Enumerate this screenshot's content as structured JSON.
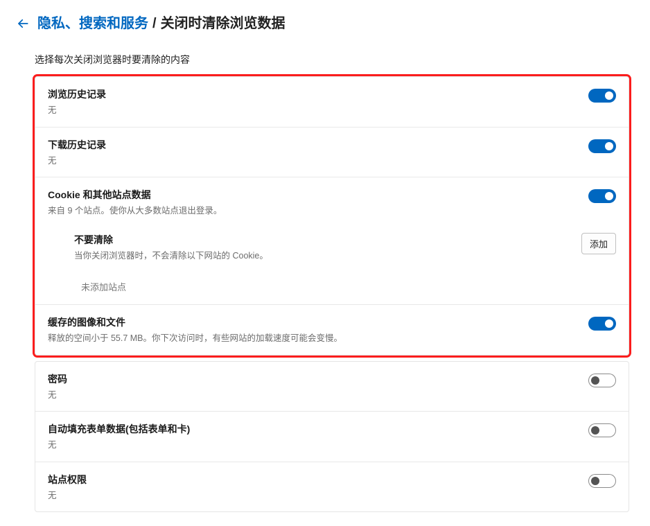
{
  "header": {
    "breadcrumb_parent": "隐私、搜索和服务",
    "breadcrumb_sep": "/",
    "breadcrumb_current": "关闭时清除浏览数据"
  },
  "intro": "选择每次关闭浏览器时要清除的内容",
  "items": [
    {
      "title": "浏览历史记录",
      "sub": "无",
      "on": true
    },
    {
      "title": "下载历史记录",
      "sub": "无",
      "on": true
    },
    {
      "title": "Cookie 和其他站点数据",
      "sub": "来自 9 个站点。使你从大多数站点退出登录。",
      "on": true,
      "cookies_sub": {
        "title": "不要清除",
        "desc": "当你关闭浏览器时，不会清除以下网站的 Cookie。",
        "add_label": "添加",
        "no_sites": "未添加站点"
      }
    },
    {
      "title": "缓存的图像和文件",
      "sub": "释放的空间小于 55.7 MB。你下次访问时，有些网站的加载速度可能会变慢。",
      "on": true
    },
    {
      "title": "密码",
      "sub": "无",
      "on": false
    },
    {
      "title": "自动填充表单数据(包括表单和卡)",
      "sub": "无",
      "on": false
    },
    {
      "title": "站点权限",
      "sub": "无",
      "on": false
    }
  ],
  "colors": {
    "accent": "#0067c0",
    "highlight": "#fb0a0a"
  }
}
